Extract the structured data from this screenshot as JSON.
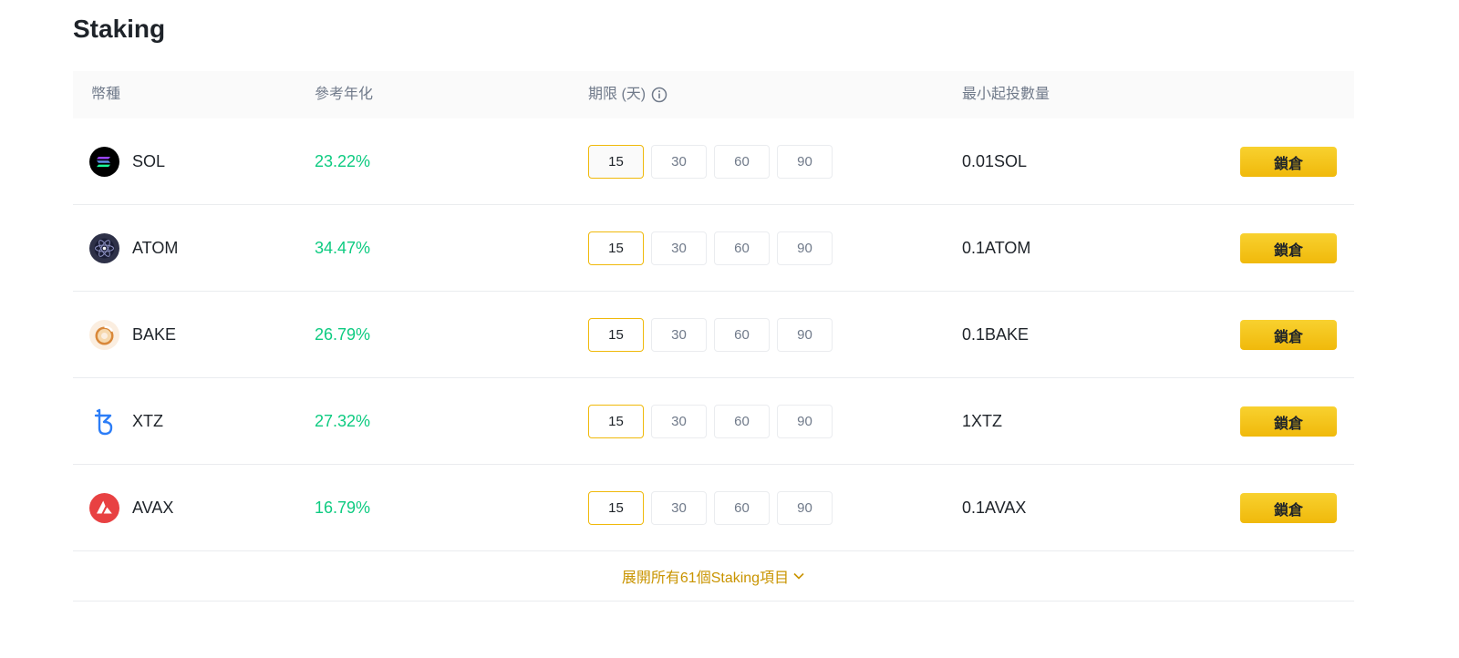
{
  "page": {
    "title": "Staking"
  },
  "table": {
    "headers": {
      "coin": "幣種",
      "apy": "參考年化",
      "term": "期限 (天)",
      "min": "最小起投數量"
    },
    "terms": [
      "15",
      "30",
      "60",
      "90"
    ],
    "lock_label": "鎖倉",
    "rows": [
      {
        "coin": "SOL",
        "icon": "sol-icon",
        "apy": "23.22%",
        "min": "0.01SOL"
      },
      {
        "coin": "ATOM",
        "icon": "atom-icon",
        "apy": "34.47%",
        "min": "0.1ATOM"
      },
      {
        "coin": "BAKE",
        "icon": "bake-icon",
        "apy": "26.79%",
        "min": "0.1BAKE"
      },
      {
        "coin": "XTZ",
        "icon": "xtz-icon",
        "apy": "27.32%",
        "min": "1XTZ"
      },
      {
        "coin": "AVAX",
        "icon": "avax-icon",
        "apy": "16.79%",
        "min": "0.1AVAX"
      }
    ],
    "expand_label": "展開所有61個Staking項目"
  },
  "colors": {
    "accent": "#f0b90b",
    "positive": "#0ecb81",
    "link": "#c99400"
  }
}
